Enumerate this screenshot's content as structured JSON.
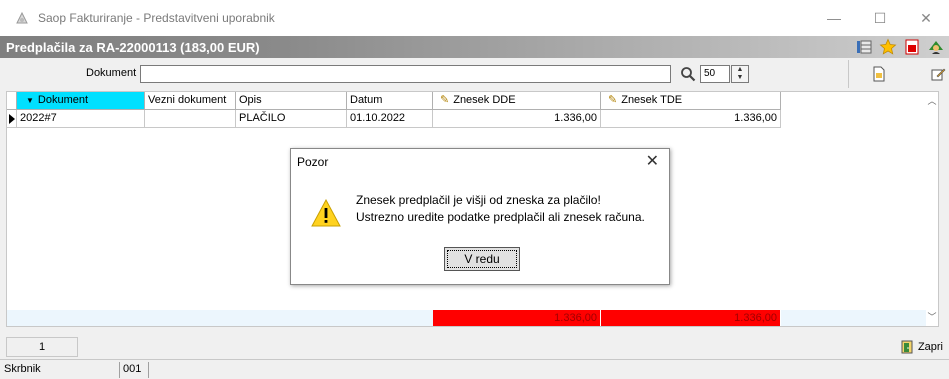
{
  "window": {
    "title": "Saop Fakturiranje - Predstavitveni uporabnik",
    "minimize": "—",
    "maximize": "☐",
    "close": "✕"
  },
  "header": {
    "title": "Predplačila za  RA-22000113  (183,00 EUR)"
  },
  "filter": {
    "label": "Dokument",
    "value": "",
    "count": "50"
  },
  "grid": {
    "columns": [
      "Dokument",
      "Vezni dokument",
      "Opis",
      "Datum",
      "Znesek DDE",
      "Znesek TDE"
    ],
    "rows": [
      {
        "dokument": "2022#7",
        "vezni": "",
        "opis": "PLAČILO",
        "datum": "01.10.2022",
        "znesek_dde": "1.336,00",
        "znesek_tde": "1.336,00"
      }
    ],
    "totals": {
      "znesek_dde": "1.336,00",
      "znesek_tde": "1.336,00"
    }
  },
  "pager": {
    "page": "1"
  },
  "close_button": {
    "label": "Zapri"
  },
  "statusbar": {
    "user": "Skrbnik",
    "code": "001"
  },
  "dialog": {
    "title": "Pozor",
    "line1": "Znesek predplačil je višji od zneska za plačilo!",
    "line2": "Ustrezno uredite podatke predplačil ali znesek računa.",
    "ok_label": "V redu"
  }
}
